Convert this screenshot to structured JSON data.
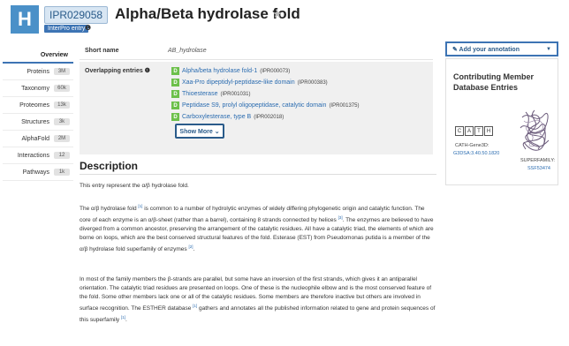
{
  "header": {
    "badge": "H",
    "accession": "IPR029058",
    "title": "Alpha/Beta hydrolase fold",
    "star": "★",
    "entry_type": "InterPro entry",
    "info": "❶"
  },
  "sidebar": {
    "overview": "Overview",
    "items": [
      {
        "label": "Proteins",
        "count": "3M"
      },
      {
        "label": "Taxonomy",
        "count": "60k"
      },
      {
        "label": "Proteomes",
        "count": "13k"
      },
      {
        "label": "Structures",
        "count": "3k"
      },
      {
        "label": "AlphaFold",
        "count": "2M"
      },
      {
        "label": "Interactions",
        "count": "12"
      },
      {
        "label": "Pathways",
        "count": "1k"
      }
    ]
  },
  "overview": {
    "short_name_label": "Short name",
    "short_name_value": "AB_hydrolase",
    "overlapping_label": "Overlapping entries ❶",
    "overlapping": [
      {
        "badge": "D",
        "name": "Alpha/beta hydrolase fold-1",
        "acc": "(IPR000073)"
      },
      {
        "badge": "D",
        "name": "Xaa-Pro dipeptidyl-peptidase-like domain",
        "acc": "(IPR000383)"
      },
      {
        "badge": "D",
        "name": "Thioesterase",
        "acc": "(IPR001031)"
      },
      {
        "badge": "D",
        "name": "Peptidase S9, prolyl oligopeptidase, catalytic domain",
        "acc": "(IPR001375)"
      },
      {
        "badge": "D",
        "name": "Carboxylesterase, type B",
        "acc": "(IPR002018)"
      }
    ],
    "show_more": "Show More ⌄"
  },
  "right": {
    "annotation_btn": "✎ Add your annotation",
    "caret": "▼",
    "member_title": "Contributing Member Database Entries",
    "cath_letters": [
      "C",
      "A",
      "T",
      "H"
    ],
    "cath_label": "CATH-Gene3D:",
    "cath_link": "G3DSA:3.40.50.1820",
    "sf_label": "SUPERFAMILY:",
    "sf_link": "SSF53474"
  },
  "description": {
    "title": "Description",
    "p1": "This entry represent the α/β hydrolase fold.",
    "p2_a": "The α/β hydrolase fold ",
    "p2_ref1": "[1]",
    "p2_b": " is common to a number of hydrolytic enzymes of widely differing phylogenetic origin and catalytic function. The core of each enzyme is an α/β-sheet (rather than a barrel), containing 8 strands connected by helices ",
    "p2_ref2": "[3]",
    "p2_c": ". The enzymes are believed to have diverged from a common ancestor, preserving the arrangement of the catalytic residues. All have a catalytic triad, the elements of which are borne on loops, which are the best conserved structural features of the fold. Esterase (EST) from Pseudomonas putida is a member of the α/β hydrolase fold superfamily of enzymes ",
    "p2_ref3": "[2]",
    "p2_d": ".",
    "p3_a": "In most of the family members the β-strands are parallel, but some have an inversion of the first strands, which gives it an antiparallel orientation. The catalytic triad residues are presented on loops. One of these is the nucleophile elbow and is the most conserved feature of the fold. Some other members lack one or all of the catalytic residues. Some members are therefore inactive but others are involved in surface recognition. The ESTHER database ",
    "p3_ref1": "[1]",
    "p3_b": " gathers and annotates all the published information related to gene and protein sequences of this superfamily ",
    "p3_ref2": "[1]",
    "p3_c": "."
  }
}
